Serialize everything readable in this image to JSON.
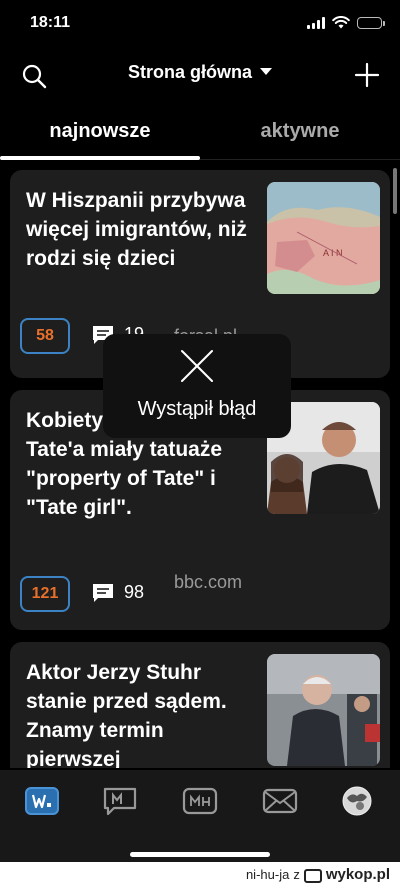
{
  "status": {
    "time": "18:11"
  },
  "header": {
    "title": "Strona główna"
  },
  "tabs": [
    {
      "label": "najnowsze",
      "selected": true
    },
    {
      "label": "aktywne",
      "selected": false
    }
  ],
  "articles": [
    {
      "title": "W Hiszpanii przybywa więcej imigrantów, niż rodzi się dzieci",
      "votes": "58",
      "comments": "19",
      "source": "forsal.pl"
    },
    {
      "title": "Kobiety w posiadłości Tate'a miały tatuaże \"property of Tate\" i \"Tate girl\".",
      "votes": "121",
      "comments": "98",
      "source": "bbc.com"
    },
    {
      "title": "Aktor Jerzy Stuhr stanie przed sądem. Znamy termin pierwszej",
      "votes": "",
      "comments": "",
      "source": ""
    }
  ],
  "toast": {
    "message": "Wystąpił błąd"
  },
  "footer": {
    "user": "ni-hu-ja",
    "separator": "z",
    "brand": "wykop.pl"
  },
  "colors": {
    "background": "#000000",
    "card": "#1e1e1e",
    "vote_border": "#3b83c4",
    "vote_text": "#e8702a",
    "tab_bar": "#181818"
  }
}
